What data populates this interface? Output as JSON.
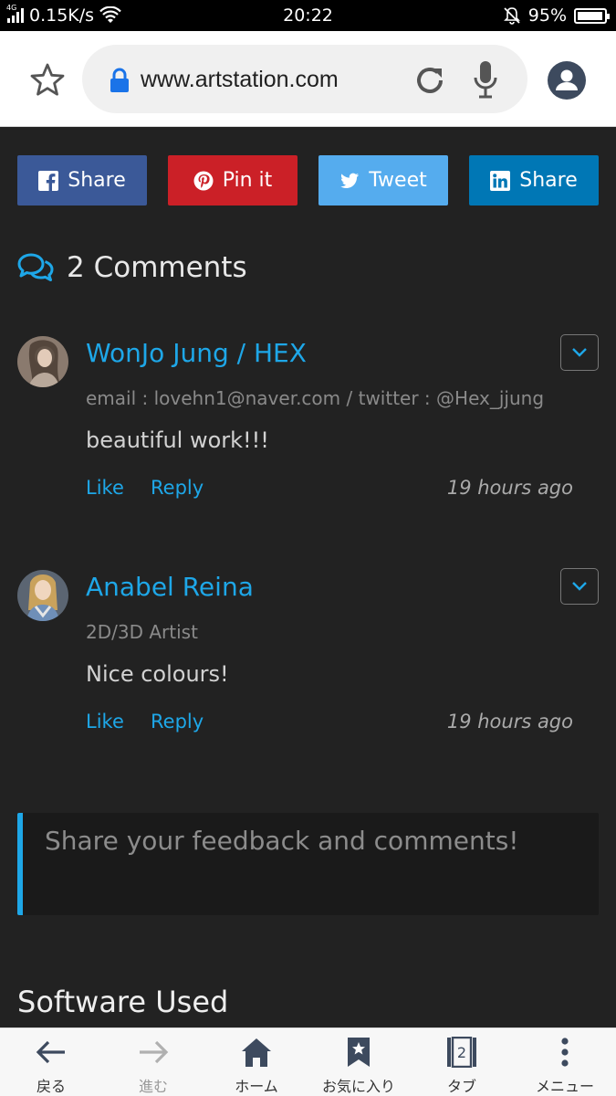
{
  "status_bar": {
    "network_type": "4G",
    "speed": "0.15K/s",
    "time": "20:22",
    "battery_percent": "95%",
    "battery_level": 0.95
  },
  "browser": {
    "url": "www.artstation.com"
  },
  "share_buttons": [
    {
      "label": "Share",
      "network": "facebook",
      "color": "#3b5998",
      "icon": "facebook-icon"
    },
    {
      "label": "Pin it",
      "network": "pinterest",
      "color": "#cb2027",
      "icon": "pinterest-icon"
    },
    {
      "label": "Tweet",
      "network": "twitter",
      "color": "#55acee",
      "icon": "twitter-icon"
    },
    {
      "label": "Share",
      "network": "linkedin",
      "color": "#0077b5",
      "icon": "linkedin-icon"
    }
  ],
  "comments_section": {
    "header": "2 Comments",
    "items": [
      {
        "author": "WonJo Jung / HEX",
        "subtitle": "email : lovehn1@naver.com / twitter : @Hex_jjung",
        "body": "beautiful work!!!",
        "like_label": "Like",
        "reply_label": "Reply",
        "time": "19 hours ago"
      },
      {
        "author": "Anabel Reina",
        "subtitle": "2D/3D Artist",
        "body": "Nice colours!",
        "like_label": "Like",
        "reply_label": "Reply",
        "time": "19 hours ago"
      }
    ]
  },
  "feedback": {
    "placeholder": "Share your feedback and comments!"
  },
  "software_section": {
    "title": "Software Used"
  },
  "bottom_nav": {
    "items": [
      {
        "label": "戻る",
        "icon": "back-arrow-icon"
      },
      {
        "label": "進む",
        "icon": "forward-arrow-icon"
      },
      {
        "label": "ホーム",
        "icon": "home-icon"
      },
      {
        "label": "お気に入り",
        "icon": "bookmark-star-icon"
      },
      {
        "label": "タブ",
        "icon": "tabs-icon",
        "count": "2"
      },
      {
        "label": "メニュー",
        "icon": "menu-dots-icon"
      }
    ]
  },
  "colors": {
    "accent": "#1ea7e8",
    "background": "#222222"
  }
}
